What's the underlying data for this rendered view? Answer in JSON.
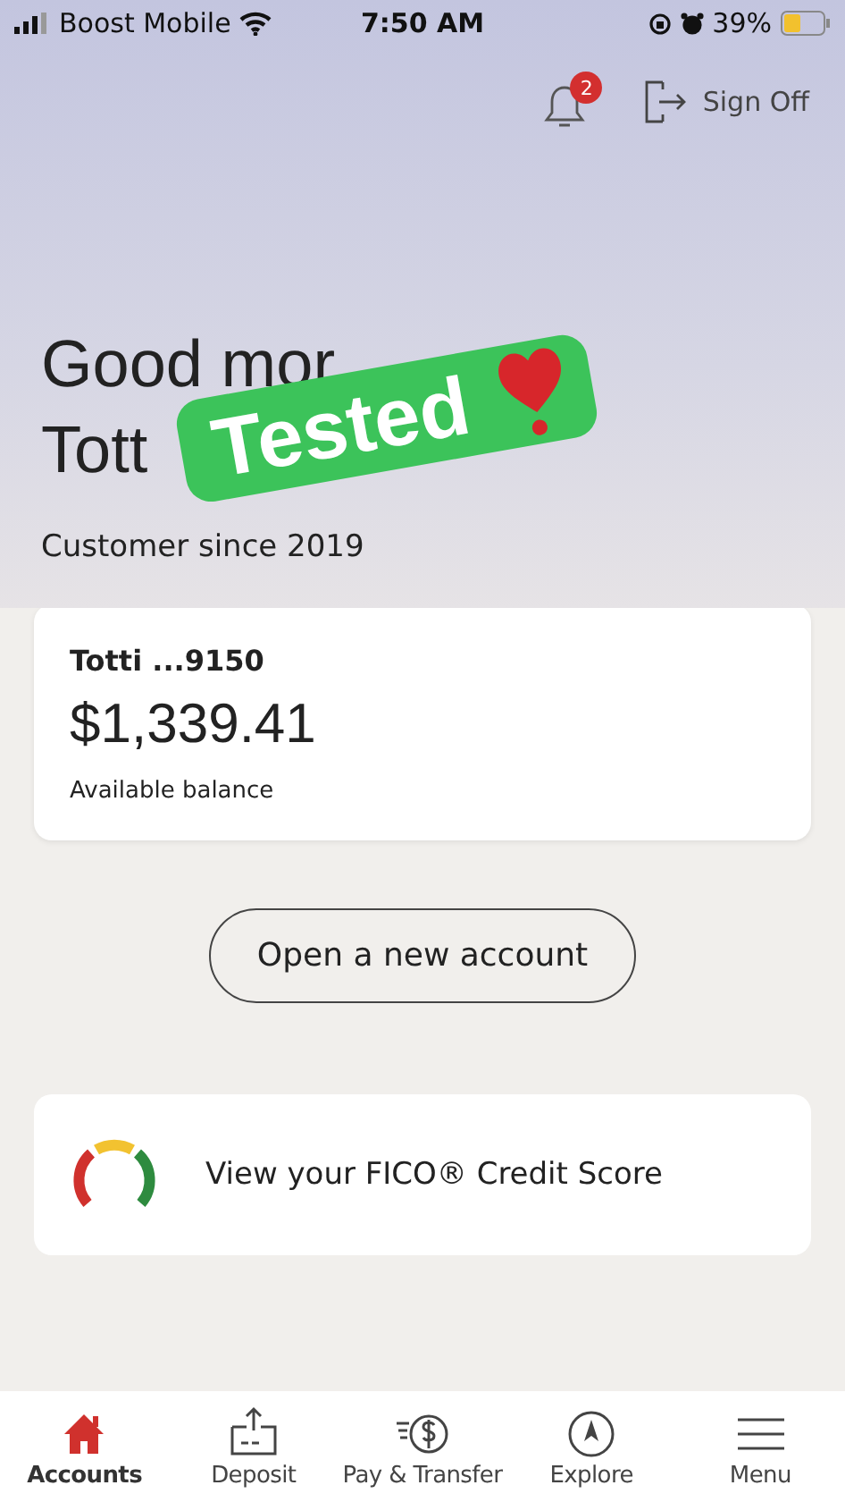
{
  "status_bar": {
    "carrier": "Boost Mobile",
    "time": "7:50 AM",
    "battery": "39%"
  },
  "header": {
    "notification_count": "2",
    "sign_off": "Sign Off"
  },
  "greeting": {
    "line_1": "Good mor",
    "line_2": "Tott",
    "subtitle": "Customer since 2019"
  },
  "sticker": {
    "text": "Tested"
  },
  "account": {
    "name": "Totti ...9150",
    "balance": "$1,339.41",
    "balance_label": "Available balance"
  },
  "open_account_button": "Open a new account",
  "fico_card": {
    "text": "View your FICO® Credit Score"
  },
  "tabs": [
    {
      "label": "Accounts",
      "kind": "home",
      "selected": true
    },
    {
      "label": "Deposit",
      "kind": "deposit",
      "selected": false
    },
    {
      "label": "Pay & Transfer",
      "kind": "pay",
      "selected": false
    },
    {
      "label": "Explore",
      "kind": "explore",
      "selected": false
    },
    {
      "label": "Menu",
      "kind": "menu",
      "selected": false
    }
  ]
}
